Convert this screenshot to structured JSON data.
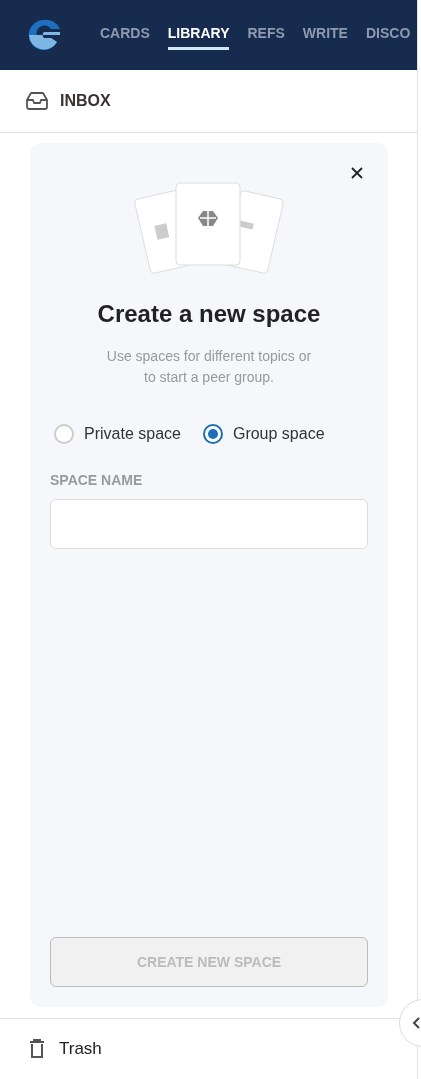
{
  "nav": {
    "tabs": [
      {
        "label": "CARDS",
        "selected": false
      },
      {
        "label": "LIBRARY",
        "selected": true
      },
      {
        "label": "REFS",
        "selected": false
      },
      {
        "label": "WRITE",
        "selected": false
      },
      {
        "label": "DISCO",
        "selected": false
      }
    ]
  },
  "section": {
    "label": "INBOX"
  },
  "dialog": {
    "title": "Create a new space",
    "subtitle": "Use spaces for different topics or to start a peer group.",
    "options": [
      {
        "label": "Private space",
        "selected": false
      },
      {
        "label": "Group space",
        "selected": true
      }
    ],
    "field_label": "SPACE NAME",
    "button": {
      "label": "CREATE NEW SPACE",
      "disabled": true
    }
  },
  "footer": {
    "label": "Trash"
  }
}
